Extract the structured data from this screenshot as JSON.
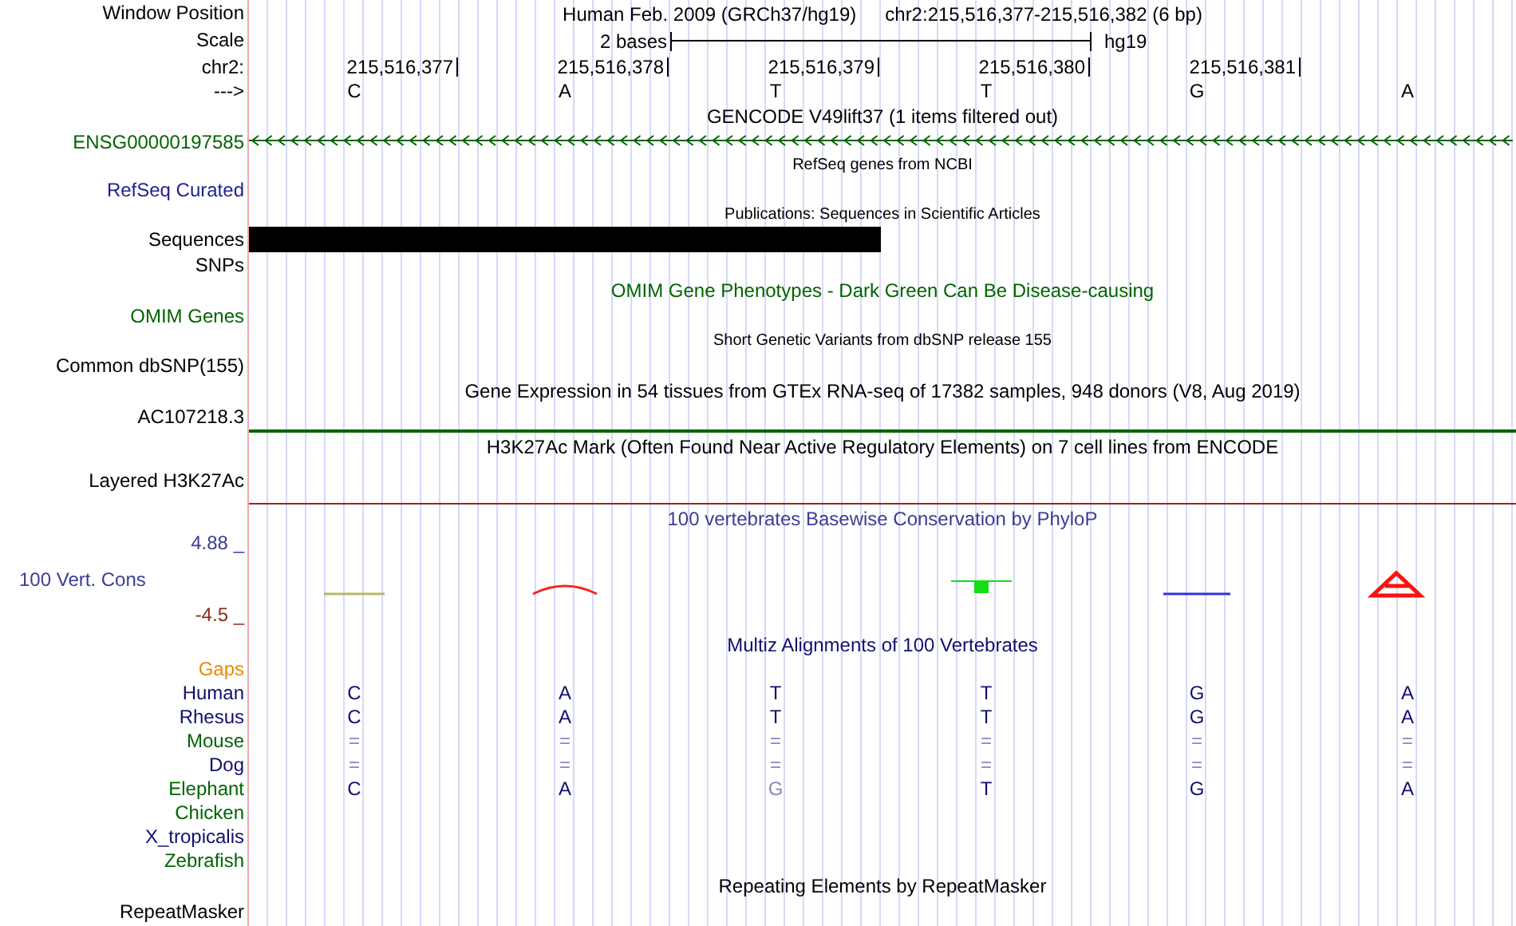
{
  "header": {
    "window_position_label": "Window Position",
    "assembly": "Human Feb. 2009 (GRCh37/hg19)",
    "range": "chr2:215,516,377-215,516,382 (6 bp)",
    "scale_label": "Scale",
    "scale_text": "2 bases",
    "scale_assembly": "hg19",
    "chrom_label": "chr2:",
    "positions": [
      "215,516,377",
      "215,516,378",
      "215,516,379",
      "215,516,380",
      "215,516,381"
    ],
    "strand_label": "--->",
    "bases": [
      "C",
      "A",
      "T",
      "T",
      "G",
      "A"
    ]
  },
  "tracks": [
    {
      "kind": "gene",
      "title": {
        "kind": "main",
        "text": "GENCODE V49lift37 (1 items filtered out)",
        "color": "#000000"
      },
      "label": "ENSG00000197585",
      "color": "#006400"
    },
    {
      "kind": "plain",
      "title": {
        "kind": "note",
        "text": "RefSeq genes from NCBI",
        "color": "#000000"
      },
      "label": "RefSeq Curated",
      "color": "#1f1f8f"
    },
    {
      "kind": "bar",
      "title": {
        "kind": "note",
        "text": "Publications: Sequences in Scientific Articles",
        "color": "#000000"
      },
      "label": "Sequences",
      "color": "#000000"
    },
    {
      "kind": "plain",
      "label": "SNPs",
      "color": "#000000"
    },
    {
      "kind": "plain",
      "title": {
        "kind": "main",
        "text": "OMIM Gene Phenotypes - Dark Green Can Be Disease-causing",
        "color": "#006400"
      },
      "label": "OMIM Genes",
      "color": "#006400"
    },
    {
      "kind": "plain",
      "title": {
        "kind": "note",
        "text": "Short Genetic Variants from dbSNP release 155",
        "color": "#000000"
      },
      "label": "Common dbSNP(155)",
      "color": "#000000"
    },
    {
      "kind": "line",
      "title": {
        "kind": "main",
        "text": "Gene Expression in 54 tissues from GTEx RNA-seq of 17382 samples, 948 donors (V8, Aug 2019)",
        "color": "#000000"
      },
      "label": "AC107218.3",
      "color": "#000000"
    },
    {
      "kind": "tall",
      "title": {
        "kind": "main",
        "text": "H3K27Ac Mark (Often Found Near Active Regulatory Elements) on 7 cell lines from ENCODE",
        "color": "#000000"
      },
      "label": "Layered H3K27Ac",
      "color": "#000000"
    },
    {
      "kind": "wiggle",
      "title": {
        "kind": "main",
        "text": "100 vertebrates Basewise Conservation by PhyloP",
        "color": "#3c3c96"
      },
      "label": "100 Vert. Cons",
      "color": "#3c3c96",
      "ymax": "4.88 _",
      "ymin": "-4.5 _"
    },
    {
      "kind": "alignment",
      "title": {
        "kind": "main",
        "text": "Multiz Alignments of 100 Vertebrates",
        "color": "#10106e"
      },
      "species": [
        {
          "name": "Gaps",
          "color": "#e88a00"
        },
        {
          "name": "Human",
          "color": "#10106e",
          "bases": [
            {
              "base": "C",
              "faded": false
            },
            {
              "base": "A",
              "faded": false
            },
            {
              "base": "T",
              "faded": false
            },
            {
              "base": "T",
              "faded": false
            },
            {
              "base": "G",
              "faded": false
            },
            {
              "base": "A",
              "faded": false
            }
          ]
        },
        {
          "name": "Rhesus",
          "color": "#10106e",
          "bases": [
            {
              "base": "C",
              "faded": false
            },
            {
              "base": "A",
              "faded": false
            },
            {
              "base": "T",
              "faded": false
            },
            {
              "base": "T",
              "faded": false
            },
            {
              "base": "G",
              "faded": false
            },
            {
              "base": "A",
              "faded": false
            }
          ]
        },
        {
          "name": "Mouse",
          "color": "#006400",
          "bases": [
            {
              "base": "=",
              "faded": true
            },
            {
              "base": "=",
              "faded": true
            },
            {
              "base": "=",
              "faded": true
            },
            {
              "base": "=",
              "faded": true
            },
            {
              "base": "=",
              "faded": true
            },
            {
              "base": "=",
              "faded": true
            }
          ]
        },
        {
          "name": "Dog",
          "color": "#10106e",
          "bases": [
            {
              "base": "=",
              "faded": true
            },
            {
              "base": "=",
              "faded": true
            },
            {
              "base": "=",
              "faded": true
            },
            {
              "base": "=",
              "faded": true
            },
            {
              "base": "=",
              "faded": true
            },
            {
              "base": "=",
              "faded": true
            }
          ]
        },
        {
          "name": "Elephant",
          "color": "#006400",
          "bases": [
            {
              "base": "C",
              "faded": false
            },
            {
              "base": "A",
              "faded": false
            },
            {
              "base": "G",
              "faded": true
            },
            {
              "base": "T",
              "faded": false
            },
            {
              "base": "G",
              "faded": false
            },
            {
              "base": "A",
              "faded": false
            }
          ]
        },
        {
          "name": "Chicken",
          "color": "#006400"
        },
        {
          "name": "X_tropicalis",
          "color": "#10106e"
        },
        {
          "name": "Zebrafish",
          "color": "#006400"
        }
      ]
    },
    {
      "kind": "plain",
      "title": {
        "kind": "main",
        "text": "Repeating Elements by RepeatMasker",
        "color": "#000000"
      },
      "label": "RepeatMasker",
      "color": "#000000"
    }
  ]
}
